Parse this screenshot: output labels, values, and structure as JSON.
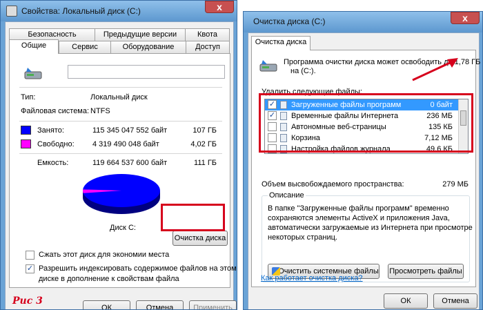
{
  "props_window": {
    "title": "Свойства: Локальный диск (C:)",
    "tabs_row1": [
      "Безопасность",
      "Предыдущие версии",
      "Квота"
    ],
    "tabs_row2": [
      "Общие",
      "Сервис",
      "Оборудование",
      "Доступ"
    ],
    "active_tab": "Общие",
    "label_input_value": "",
    "type_label": "Тип:",
    "type_value": "Локальный диск",
    "fs_label": "Файловая система:",
    "fs_value": "NTFS",
    "used": {
      "label": "Занято:",
      "bytes": "115 345 047 552 байт",
      "size": "107 ГБ",
      "color": "#0000ff"
    },
    "free": {
      "label": "Свободно:",
      "bytes": "4 319 490 048 байт",
      "size": "4,02 ГБ",
      "color": "#ff00ff"
    },
    "capacity": {
      "label": "Емкость:",
      "bytes": "119 664 537 600 байт",
      "size": "111 ГБ"
    },
    "used_fraction": 0.964,
    "disk_label": "Диск C:",
    "cleanup_button": "Очистка диска",
    "compress_label": "Сжать этот диск для экономии места",
    "compress_checked": false,
    "index_label_1": "Разрешить индексировать содержимое файлов на этом",
    "index_label_2": "диске в дополнение к свойствам файла",
    "index_checked": true,
    "ok_button": "ОК",
    "cancel_button": "Отмена",
    "apply_button": "Применить",
    "caption": "Рис 3",
    "close_glyph": "x"
  },
  "cleanup_window": {
    "title": "Очистка диска  (C:)",
    "tab": "Очистка диска",
    "summary_1": "Программа очистки диска может освободить до 1,78 ГБ",
    "summary_2": "на  (C:).",
    "delete_label": "Удалить следующие файлы:",
    "files": [
      {
        "name": "Загруженные файлы программ",
        "size": "0 байт",
        "checked": true,
        "selected": true
      },
      {
        "name": "Временные файлы Интернета",
        "size": "236 МБ",
        "checked": true,
        "selected": false
      },
      {
        "name": "Автономные веб-страницы",
        "size": "135 КБ",
        "checked": false,
        "selected": false
      },
      {
        "name": "Корзина",
        "size": "7,12 МБ",
        "checked": false,
        "selected": false
      },
      {
        "name": "Настройка файлов журнала",
        "size": "49,6 КБ",
        "checked": false,
        "selected": false
      }
    ],
    "space_label": "Объем высвобождаемого пространства:",
    "space_value": "279 МБ",
    "description_title": "Описание",
    "description_lines": [
      "В папке \"Загруженные файлы программ\" временно",
      "сохраняются элементы ActiveX и приложения Java,",
      "автоматически загружаемые из Интернета при просмотре",
      "некоторых страниц."
    ],
    "clean_system_button": "Очистить системные файлы",
    "view_files_button": "Просмотреть файлы",
    "help_link": "Как работает очистка диска?",
    "ok_button": "ОК",
    "cancel_button": "Отмена",
    "close_glyph": "x",
    "accent_red": "#d6001c"
  }
}
